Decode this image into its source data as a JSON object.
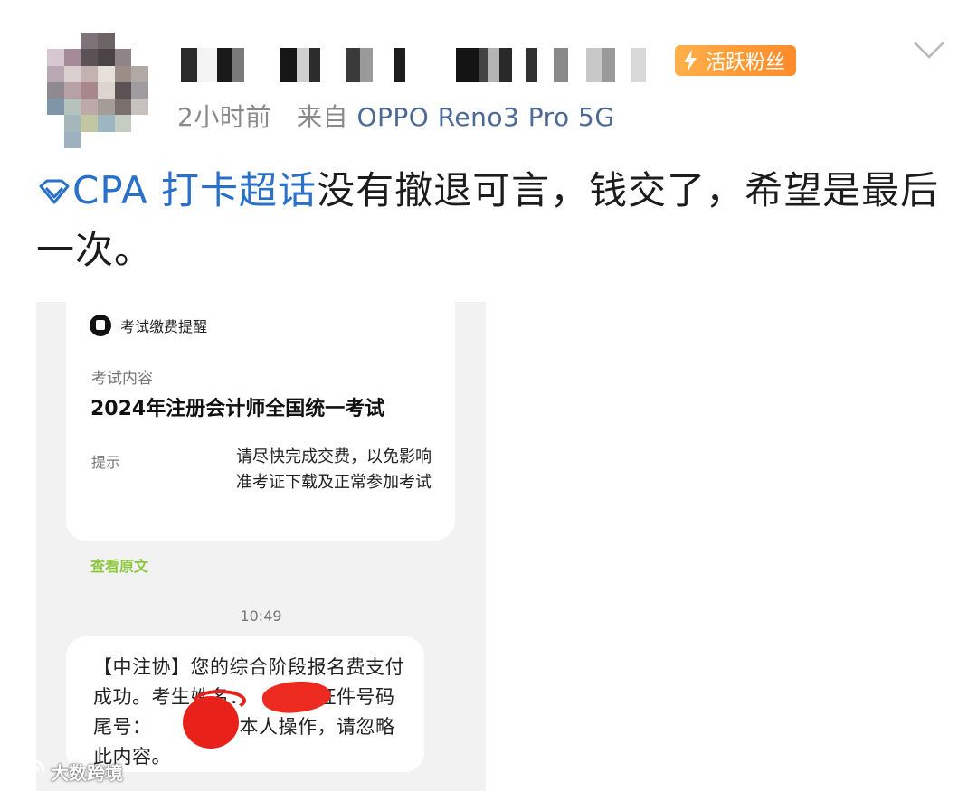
{
  "post": {
    "badge": "活跃粉丝",
    "time": "2小时前",
    "source_prefix": "来自",
    "device": "OPPO Reno3 Pro 5G",
    "topic": "CPA 打卡超话",
    "text": "没有撤退可言，钱交了，希望是最后一次。"
  },
  "screenshot": {
    "card_title": "考试缴费提醒",
    "content_label": "考试内容",
    "exam_name": "2024年注册会计师全国统一考试",
    "tip_label": "提示",
    "tip_text": "请尽快完成交费，以免影响准考证下载及正常参加考试",
    "view_original": "查看原文",
    "time": "10:49",
    "sms_text": "【中注协】您的综合阶段报名费支付成功。考生姓名：　　　，证件号码尾号：　　　如非本人操作，请忽略此内容。"
  },
  "watermark": "大数跨境",
  "colors": {
    "topic_blue": "#2a6fc9",
    "device_blue": "#4d6a94",
    "badge_orange": "#ff8a2a",
    "link_green": "#8ec63f",
    "redaction_red": "#e8221b"
  }
}
